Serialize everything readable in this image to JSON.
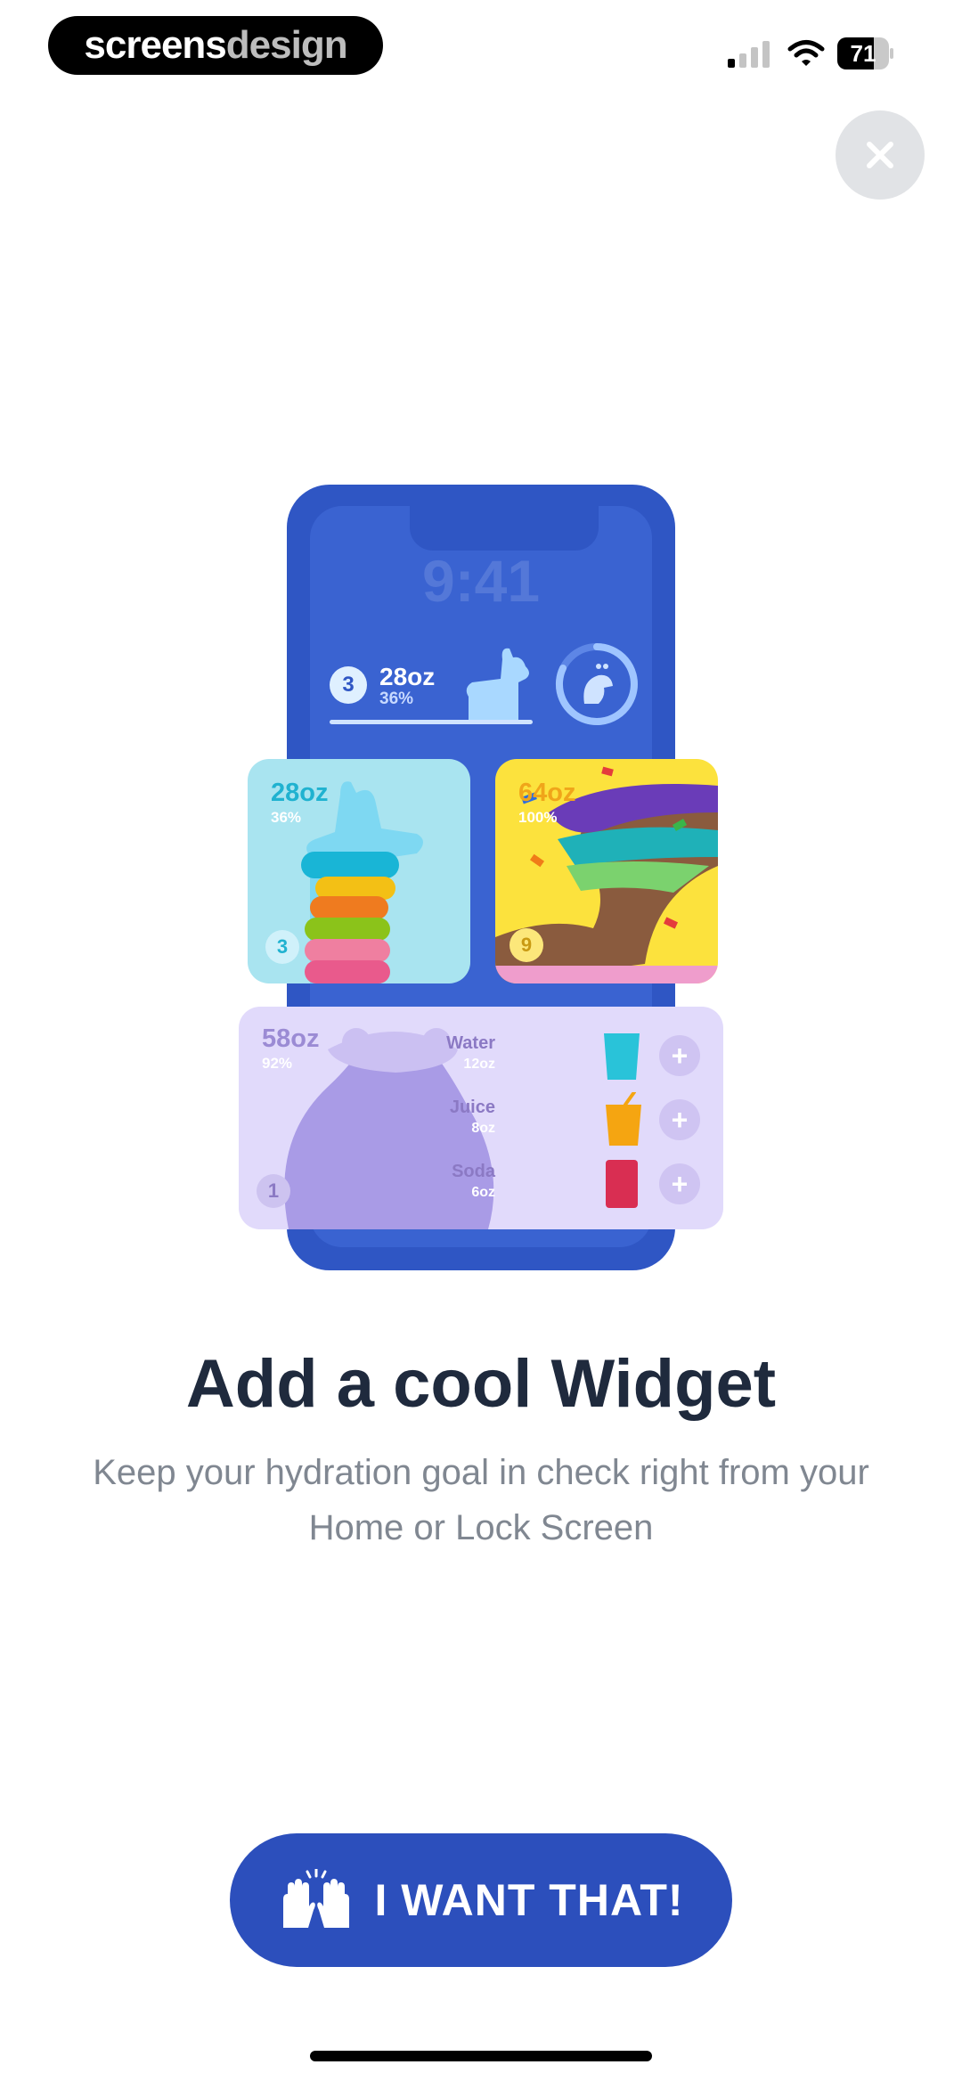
{
  "watermark": {
    "part1": "screens",
    "part2": "design"
  },
  "status_bar": {
    "battery": "71",
    "battery_level": 0.71
  },
  "illustration": {
    "lock_screen_time": "9:41",
    "lock_widget": {
      "badge": "3",
      "amount": "28oz",
      "percent": "36%"
    },
    "llama_widget": {
      "amount": "28oz",
      "percent": "36%",
      "badge": "3"
    },
    "peacock_widget": {
      "amount": "64oz",
      "percent": "100%",
      "badge": "9"
    },
    "hippo_widget": {
      "amount": "58oz",
      "percent": "92%",
      "badge": "1",
      "drinks": [
        {
          "name": "Water",
          "size": "12oz",
          "color": "#29c3d9"
        },
        {
          "name": "Juice",
          "size": "8oz",
          "color": "#f5a511"
        },
        {
          "name": "Soda",
          "size": "6oz",
          "color": "#d92e52"
        }
      ],
      "add_symbol": "+"
    }
  },
  "content": {
    "title": "Add a cool Widget",
    "subtitle": "Keep your hydration goal in check right from your Home or Lock Screen"
  },
  "cta": {
    "label": "I WANT THAT!"
  },
  "colors": {
    "primary": "#2c4fbc",
    "title": "#1f2a3d",
    "subtitle": "#808791"
  }
}
